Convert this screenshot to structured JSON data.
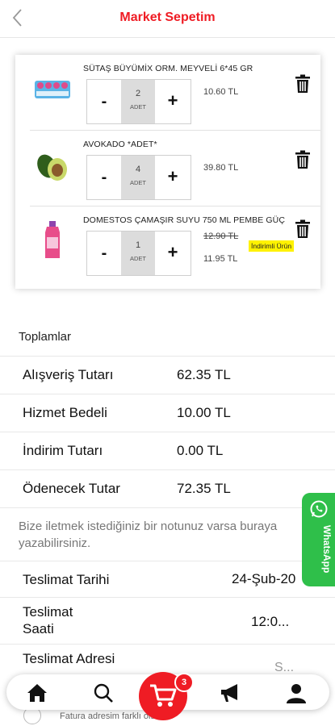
{
  "header": {
    "title": "Market Sepetim"
  },
  "cart": {
    "items": [
      {
        "name": "SÜTAŞ BÜYÜMİX ORM. MEYVELİ 6*45 GR",
        "qty": "2",
        "unit": "ADET",
        "price": "10.60 TL"
      },
      {
        "name": "AVOKADO *ADET*",
        "qty": "4",
        "unit": "ADET",
        "price": "39.80 TL"
      },
      {
        "name": "DOMESTOS ÇAMAŞIR SUYU 750 ML PEMBE GÜÇ",
        "qty": "1",
        "unit": "ADET",
        "old_price": "12.90 TL",
        "new_price": "11.95 TL",
        "badge": "İndirimli Ürün"
      }
    ],
    "minus_label": "-",
    "plus_label": "+"
  },
  "totals": {
    "title": "Toplamlar",
    "rows": [
      {
        "label": "Alışveriş Tutarı",
        "value": "62.35 TL"
      },
      {
        "label": "Hizmet Bedeli",
        "value": "10.00 TL"
      },
      {
        "label": "İndirim Tutarı",
        "value": "0.00 TL"
      },
      {
        "label": "Ödenecek Tutar",
        "value": "72.35 TL"
      }
    ]
  },
  "note_placeholder": "Bize iletmek istediğiniz bir notunuz varsa buraya yazabilirsiniz.",
  "delivery": {
    "date_label": "Teslimat Tarihi",
    "date_value": "24-Şub-20",
    "time_label": "Teslimat Saati",
    "time_value": "12:0...",
    "address_label": "Teslimat Adresi",
    "address_value": "S..."
  },
  "invoice": {
    "text": "Fatura adresim farklı olsun."
  },
  "whatsapp": {
    "label": "WhatsApp",
    "color": "#2fbf4a"
  },
  "nav": {
    "cart_count": "3"
  },
  "colors": {
    "accent": "#ef1c24",
    "badge_bg": "#fff200"
  }
}
